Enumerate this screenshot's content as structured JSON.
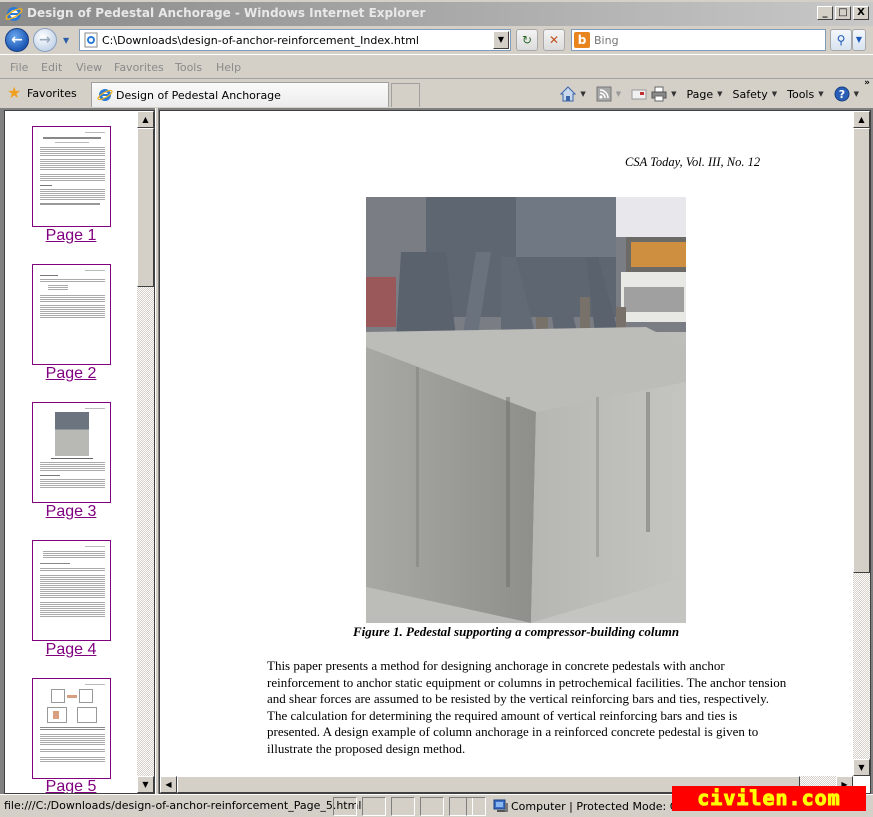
{
  "window": {
    "title": "Design of Pedestal Anchorage - Windows Internet Explorer",
    "controls": {
      "minimize": "_",
      "maximize": "□",
      "close": "X"
    }
  },
  "address_bar": {
    "url": "C:\\Downloads\\design-of-anchor-reinforcement_Index.html",
    "back_icon": "←",
    "forward_icon": "→",
    "refresh_icon": "↻",
    "stop_icon": "✕",
    "search_placeholder": "Bing",
    "search_logo": "b",
    "search_icon": "⚲"
  },
  "menu": {
    "items": [
      "File",
      "Edit",
      "View",
      "Favorites",
      "Tools",
      "Help"
    ]
  },
  "favorites_bar": {
    "favorites_label": "Favorites",
    "tab_label": "Design of Pedestal Anchorage",
    "command_bar": {
      "page": "Page",
      "safety": "Safety",
      "tools": "Tools",
      "overflow": "»"
    }
  },
  "left_frame": {
    "thumbnails": [
      {
        "label": "Page 1"
      },
      {
        "label": "Page 2"
      },
      {
        "label": "Page 3"
      },
      {
        "label": "Page 4"
      },
      {
        "label": "Page 5"
      }
    ]
  },
  "document": {
    "journal_header": "CSA Today, Vol. III, No. 12",
    "figure_caption": "Figure 1. Pedestal supporting a compressor-building column",
    "abstract": "This paper presents a method for designing anchorage in concrete pedestals with anchor reinforcement to anchor static equipment or columns in petrochemical facilities. The anchor tension and shear forces are assumed to be resisted by the vertical reinforcing bars and ties, respectively. The calculation for determining the required amount of vertical reinforcing bars and ties is presented. A design example of column anchorage in a reinforced concrete pedestal is given to illustrate the proposed design method."
  },
  "status_bar": {
    "status_text": "file:///C:/Downloads/design-of-anchor-reinforcement_Page_5.html",
    "zone": "Computer | Protected Mode: Off"
  },
  "watermark": {
    "text": "civilen.com"
  }
}
